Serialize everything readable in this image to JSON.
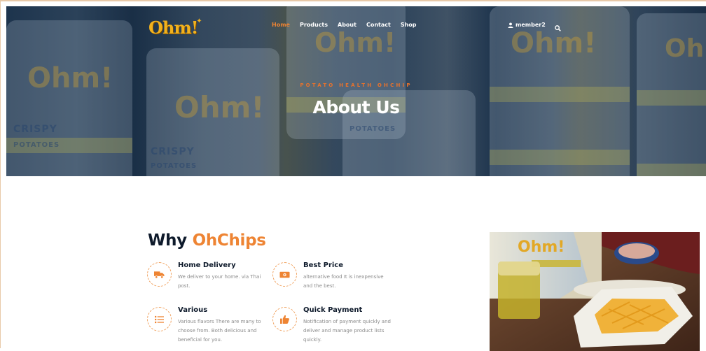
{
  "nav": {
    "brand": "Ohm!",
    "items": [
      {
        "label": "Home",
        "active": true
      },
      {
        "label": "Products",
        "active": false
      },
      {
        "label": "About",
        "active": false
      },
      {
        "label": "Contact",
        "active": false
      },
      {
        "label": "Shop",
        "active": false
      }
    ],
    "user_label": "member2",
    "user_icon": "user-icon",
    "search_icon": "search-icon"
  },
  "hero": {
    "eyebrow": "POTATO HEALTH OHCHIP",
    "title": "About Us"
  },
  "why": {
    "title_prefix": "Why",
    "title_accent": "OhChips",
    "features": [
      {
        "icon": "delivery-truck-icon",
        "title": "Home Delivery",
        "desc": "We deliver to your home. via Thai post."
      },
      {
        "icon": "money-icon",
        "title": "Best Price",
        "desc": "alternative food It is inexpensive and the best."
      },
      {
        "icon": "list-icon",
        "title": "Various",
        "desc": "Various flavors There are many to choose from. Both delicious and beneficial for you."
      },
      {
        "icon": "thumbs-up-icon",
        "title": "Quick Payment",
        "desc": "Notification of payment quickly and deliver and manage product lists quickly."
      }
    ]
  },
  "colors": {
    "accent": "#ee8433",
    "dark": "#0e1a2b",
    "muted": "#8a8a8a",
    "brand_yellow": "#f2b21d"
  }
}
